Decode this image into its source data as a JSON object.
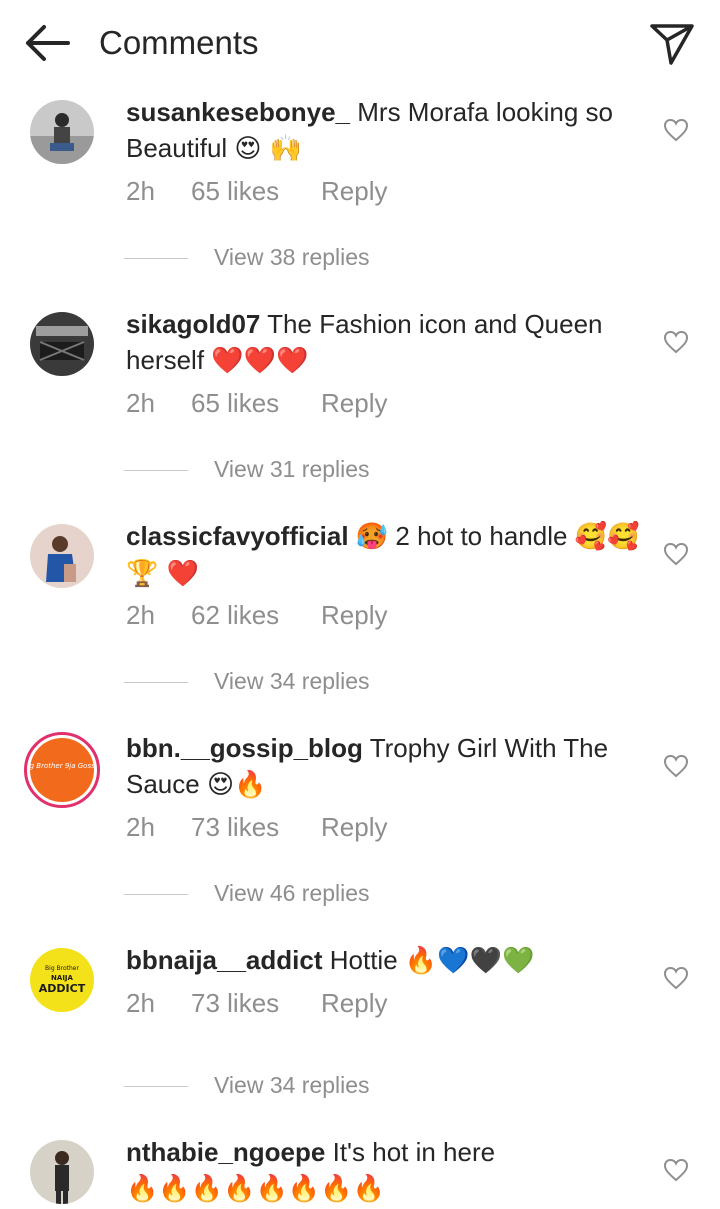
{
  "header": {
    "title": "Comments",
    "back_icon": "arrow-left-icon",
    "send_icon": "paper-plane-icon"
  },
  "comments": [
    {
      "username": "susankesebonye_",
      "text": "Mrs Morafa looking so Beautiful",
      "emojis": "😍 🙌",
      "time": "2h",
      "likes": "65 likes",
      "reply": "Reply",
      "view_replies": "View 38 replies"
    },
    {
      "username": "sikagold07",
      "text": "The Fashion icon and Queen herself",
      "emojis": "❤️❤️❤️",
      "time": "2h",
      "likes": "65 likes",
      "reply": "Reply",
      "view_replies": "View 31 replies"
    },
    {
      "username": "classicfavyofficial",
      "text": "🥵 2 hot to handle",
      "emojis": "🥰🥰🏆 ❤️",
      "time": "2h",
      "likes": "62 likes",
      "reply": "Reply",
      "view_replies": "View 34 replies"
    },
    {
      "username": "bbn.__gossip_blog",
      "text": "Trophy Girl With The Sauce",
      "emojis": "😍🔥",
      "time": "2h",
      "likes": "73 likes",
      "reply": "Reply",
      "view_replies": "View 46 replies",
      "avatar_text": "Big Brother 9ja Gossip"
    },
    {
      "username": "bbnaija__addict",
      "text": "Hottie",
      "emojis": "🔥💙🖤💚",
      "time": "2h",
      "likes": "73 likes",
      "reply": "Reply",
      "view_replies": "View 34 replies",
      "avatar_text_top": "Big Brother",
      "avatar_text_mid": "NAIJA",
      "avatar_text_bottom": "ADDICT"
    },
    {
      "username": "nthabie_ngoepe",
      "text": "It's hot in here",
      "emojis": "🔥🔥🔥🔥🔥🔥🔥🔥"
    }
  ],
  "colors": {
    "text": "#262626",
    "secondary": "#8e8e8e",
    "heart_red": "#ed4956",
    "story_ring": "#e1306c"
  }
}
